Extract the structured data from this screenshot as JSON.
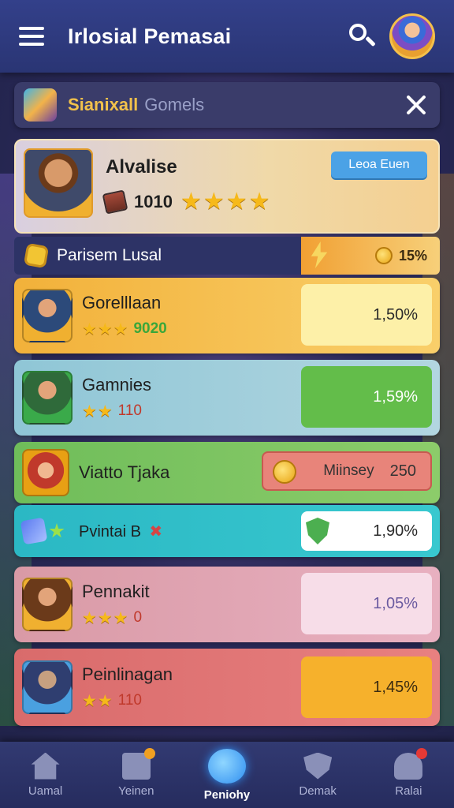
{
  "header": {
    "title": "Irlosial Pemasai"
  },
  "search_panel": {
    "title": "Sianixall",
    "subtitle": "Gomels"
  },
  "featured": {
    "name": "Alvalise",
    "score": "1010",
    "stars": "★★★★",
    "button_label": "Leoa Euen"
  },
  "section": {
    "title": "Parisem Lusal",
    "value": "15%"
  },
  "rows": [
    {
      "name": "Gorelllaan",
      "stars": "★★★",
      "score": "9020",
      "value": "1,50%"
    },
    {
      "name": "Gamnies",
      "stars": "★★",
      "score": "110",
      "value": "1,59%"
    },
    {
      "name": "Viatto Tjaka",
      "pill_text": "Miinsey",
      "pill_number": "250"
    },
    {
      "name": "Pvintai B",
      "mark": "✖",
      "value": "1,90%"
    },
    {
      "name": "Pennakit",
      "stars": "★★★",
      "score": "0",
      "value": "1,05%"
    },
    {
      "name": "Peinlinagan",
      "stars": "★★",
      "score": "110",
      "value": "1,45%"
    }
  ],
  "nav": [
    {
      "label": "Uamal",
      "icon": "home-icon"
    },
    {
      "label": "Yeinen",
      "icon": "news-icon"
    },
    {
      "label": "Peniohy",
      "icon": "active-icon"
    },
    {
      "label": "Demak",
      "icon": "shield-icon"
    },
    {
      "label": "Ralai",
      "icon": "profile-icon"
    }
  ]
}
